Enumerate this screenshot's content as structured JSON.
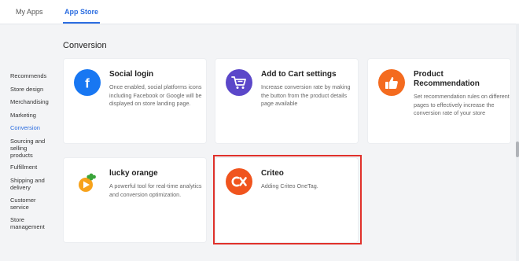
{
  "tabs": [
    {
      "label": "My Apps",
      "active": false
    },
    {
      "label": "App Store",
      "active": true
    }
  ],
  "section_title": "Conversion",
  "sidebar": {
    "items": [
      {
        "label": "Recommends"
      },
      {
        "label": "Store design"
      },
      {
        "label": "Merchandising"
      },
      {
        "label": "Marketing"
      },
      {
        "label": "Conversion",
        "active": true
      },
      {
        "label": "Sourcing and selling products"
      },
      {
        "label": "Fulfillment"
      },
      {
        "label": "Shipping and delivery"
      },
      {
        "label": "Customer service"
      },
      {
        "label": "Store management"
      }
    ]
  },
  "cards": [
    {
      "title": "Social login",
      "description": "Once enabled, social platforms icons including Facebook or Google will be displayed on store landing page.",
      "icon": "facebook-icon",
      "color": "#1877f2"
    },
    {
      "title": "Add to Cart settings",
      "description": "Increase conversion rate by making the button from the product details page available",
      "icon": "cart-icon",
      "color": "#5b47c9"
    },
    {
      "title": "Product Recommendation",
      "description": "Set recommendation rules on different pages to effectively increase the conversion rate of your store",
      "icon": "thumbs-up-icon",
      "color": "#f46b1f"
    },
    {
      "title": "lucky orange",
      "description": "A powerful tool for real-time analytics and conversion optimization.",
      "icon": "lucky-orange-icon",
      "color": "#f7a21b"
    },
    {
      "title": "Criteo",
      "description": "Adding Criteo OneTag.",
      "icon": "criteo-icon",
      "color": "#f0541e",
      "highlighted": true
    }
  ],
  "colors": {
    "accent": "#2b6de0",
    "highlight": "#e0312b"
  }
}
